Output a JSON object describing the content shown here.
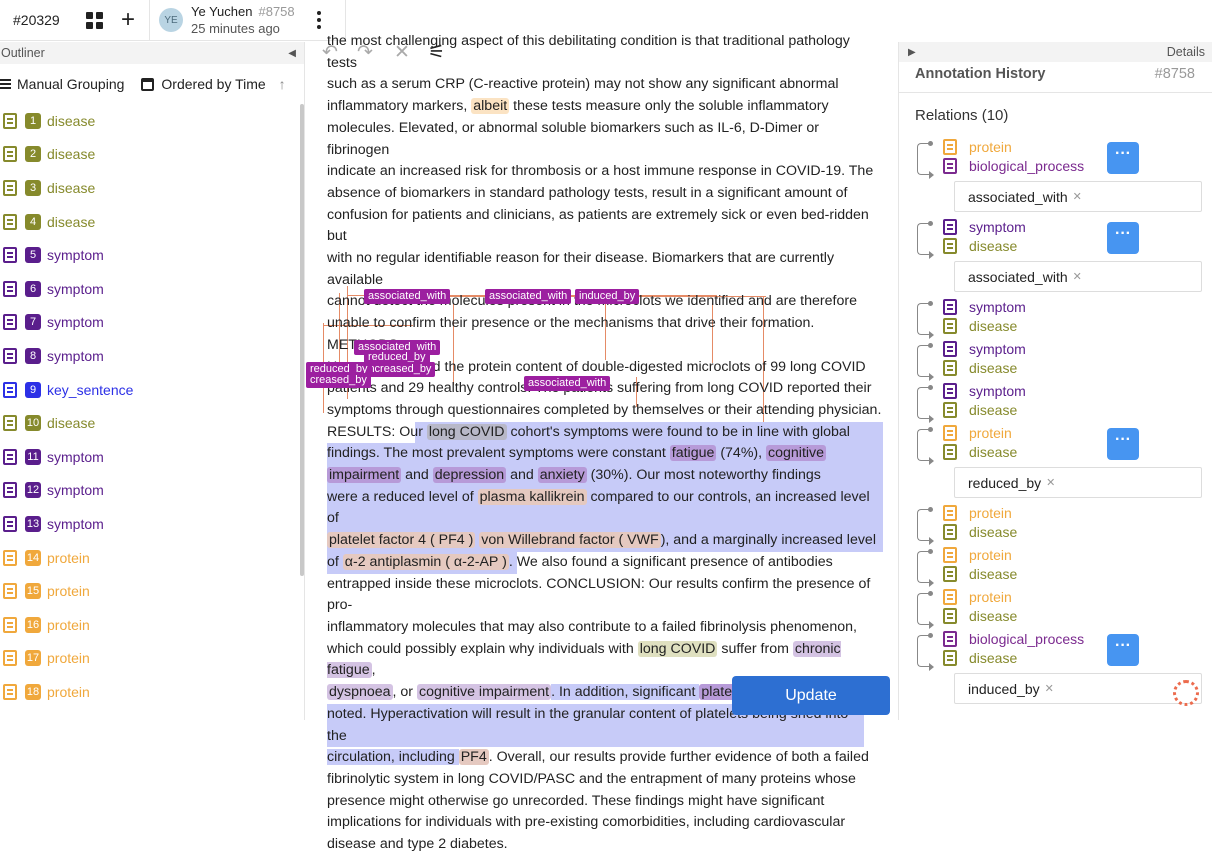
{
  "topbar": {
    "task_id": "#20329",
    "avatar_initials": "YE",
    "user_name": "Ye Yuchen",
    "user_id": "#8758",
    "time_ago": "25 minutes ago"
  },
  "outliner": {
    "title": "Outliner",
    "collapse_icon": "◀",
    "grouping_label": "Manual Grouping",
    "order_label": "Ordered by Time",
    "order_icon": "↑",
    "entities": [
      {
        "num": "1",
        "label": "disease",
        "color": "#868a2c"
      },
      {
        "num": "2",
        "label": "disease",
        "color": "#868a2c"
      },
      {
        "num": "3",
        "label": "disease",
        "color": "#868a2c"
      },
      {
        "num": "4",
        "label": "disease",
        "color": "#868a2c"
      },
      {
        "num": "5",
        "label": "symptom",
        "color": "#5a1e8c"
      },
      {
        "num": "6",
        "label": "symptom",
        "color": "#5a1e8c"
      },
      {
        "num": "7",
        "label": "symptom",
        "color": "#5a1e8c"
      },
      {
        "num": "8",
        "label": "symptom",
        "color": "#5a1e8c"
      },
      {
        "num": "9",
        "label": "key_sentence",
        "color": "#2c30e6"
      },
      {
        "num": "10",
        "label": "disease",
        "color": "#868a2c"
      },
      {
        "num": "11",
        "label": "symptom",
        "color": "#5a1e8c"
      },
      {
        "num": "12",
        "label": "symptom",
        "color": "#5a1e8c"
      },
      {
        "num": "13",
        "label": "symptom",
        "color": "#5a1e8c"
      },
      {
        "num": "14",
        "label": "protein",
        "color": "#f0a83c"
      },
      {
        "num": "15",
        "label": "protein",
        "color": "#f0a83c"
      },
      {
        "num": "16",
        "label": "protein",
        "color": "#f0a83c"
      },
      {
        "num": "17",
        "label": "protein",
        "color": "#f0a83c"
      },
      {
        "num": "18",
        "label": "protein",
        "color": "#f0a83c"
      }
    ]
  },
  "text": {
    "l1": "the most challenging aspect of this debilitating condition is that traditional pathology tests",
    "l2": "such as a serum CRP (C-reactive protein) may not show any significant abnormal",
    "l3a": "inflammatory markers, ",
    "l3b": "albeit",
    "l3c": " these tests measure only the soluble inflammatory",
    "l4": "molecules. Elevated, or abnormal soluble biomarkers such as IL-6, D-Dimer or fibrinogen",
    "l5": "indicate an increased risk for thrombosis or a host immune response in COVID-19. The",
    "l6": "absence of biomarkers in standard pathology tests, result in a significant amount of",
    "l7": "confusion for patients and clinicians, as patients are extremely sick or even bed-ridden but",
    "l8": "with no regular identifiable reason for their disease. Biomarkers that are currently available",
    "l9": "cannot detect the molecules present in the microclots we identified and are therefore",
    "l10": "unable to confirm their presence or the mechanisms that drive their formation. METHODS:",
    "l11": "Here we analysed the protein content of double-digested microclots of 99 long COVID",
    "l12": "patients and 29 healthy controls. The patients suffering from long COVID reported their",
    "l13": "symptoms through questionnaires completed by themselves or their attending physician.",
    "l14a": "RESULTS: Our ",
    "l14b": "long COVID",
    "l14c": " cohort's symptoms were found to be in line with global",
    "l15a": "findings. The most prevalent symptoms were constant ",
    "l15b": "fatigue",
    "l15c": " (74%), ",
    "l15d": "cognitive",
    "l16a": "impairment",
    "l16b": " and ",
    "l16c": "depression",
    "l16d": " and ",
    "l16e": "anxiety",
    "l16f": " (30%). Our most noteworthy findings",
    "l17a": "were a reduced level of ",
    "l17b": "plasma kallikrein",
    "l17c": " compared to our controls, an increased level of",
    "l18a": "platelet factor 4",
    "l18b": "PF4",
    "l18c": "von Willebrand factor",
    "l18d": "VWF",
    "l18e": "), and a marginally increased level",
    "l19a": "of ",
    "l19b": "α-2 antiplasmin",
    "l19c": "α-2-AP",
    "l19d": ". We also found a significant presence of antibodies",
    "l20": "entrapped inside these microclots. CONCLUSION: Our results confirm the presence of pro-",
    "l21": "inflammatory molecules that may also contribute to a failed fibrinolysis phenomenon,",
    "l22a": "which could possibly explain why individuals with ",
    "l22b": "long COVID",
    "l22c": " suffer from ",
    "l22d": "chronic fatigue",
    "l23a": "dyspnoea",
    "l23b": ", or ",
    "l23c": "cognitive impairment",
    "l23d": ". In addition, significant ",
    "l23e": "platelet hyperactivation",
    "l23f": " was",
    "l24": "noted. Hyperactivation will result in the granular content of platelets being shed into the",
    "l25a": "circulation, including ",
    "l25b": "PF4",
    "l25c": ". Overall, our results provide further evidence of both a failed",
    "l26": "fibrinolytic system in long COVID/PASC and the entrapment of many proteins whose",
    "l27": "presence might otherwise go unrecorded. These findings might have significant",
    "l28": "implications for individuals with pre-existing comorbidities, including cardiovascular",
    "l29": "disease and type 2 diabetes."
  },
  "annotations": {
    "a1": "associated_with",
    "a2": "associated_with",
    "a3": "induced_by",
    "a4": "associated_with",
    "a5": "reduced_by",
    "a6": "increased_by",
    "a7": "reduced_by",
    "a8": "creased_by",
    "a9": "associated_with"
  },
  "editor": {
    "update_label": "Update"
  },
  "details": {
    "title": "Details",
    "expand_icon": "▶",
    "history_label": "Annotation History",
    "history_id": "#8758",
    "relations_label": "Relations (10)",
    "relations": [
      {
        "from": "protein",
        "to": "biological_process",
        "tag": "associated_with"
      },
      {
        "from": "symptom",
        "to": "disease",
        "tag": "associated_with"
      },
      {
        "from": "symptom",
        "to": "disease"
      },
      {
        "from": "symptom",
        "to": "disease"
      },
      {
        "from": "symptom",
        "to": "disease"
      },
      {
        "from": "protein",
        "to": "disease",
        "tag": "reduced_by"
      },
      {
        "from": "protein",
        "to": "disease"
      },
      {
        "from": "protein",
        "to": "disease"
      },
      {
        "from": "protein",
        "to": "disease"
      },
      {
        "from": "biological_process",
        "to": "disease",
        "tag": "induced_by"
      }
    ]
  },
  "colors": {
    "disease": "#868a2c",
    "symptom": "#5a1e8c",
    "key_sentence": "#2c30e6",
    "protein": "#f0a83c",
    "biological_process": "#7b2a8f",
    "accent": "#2d6fd2"
  }
}
